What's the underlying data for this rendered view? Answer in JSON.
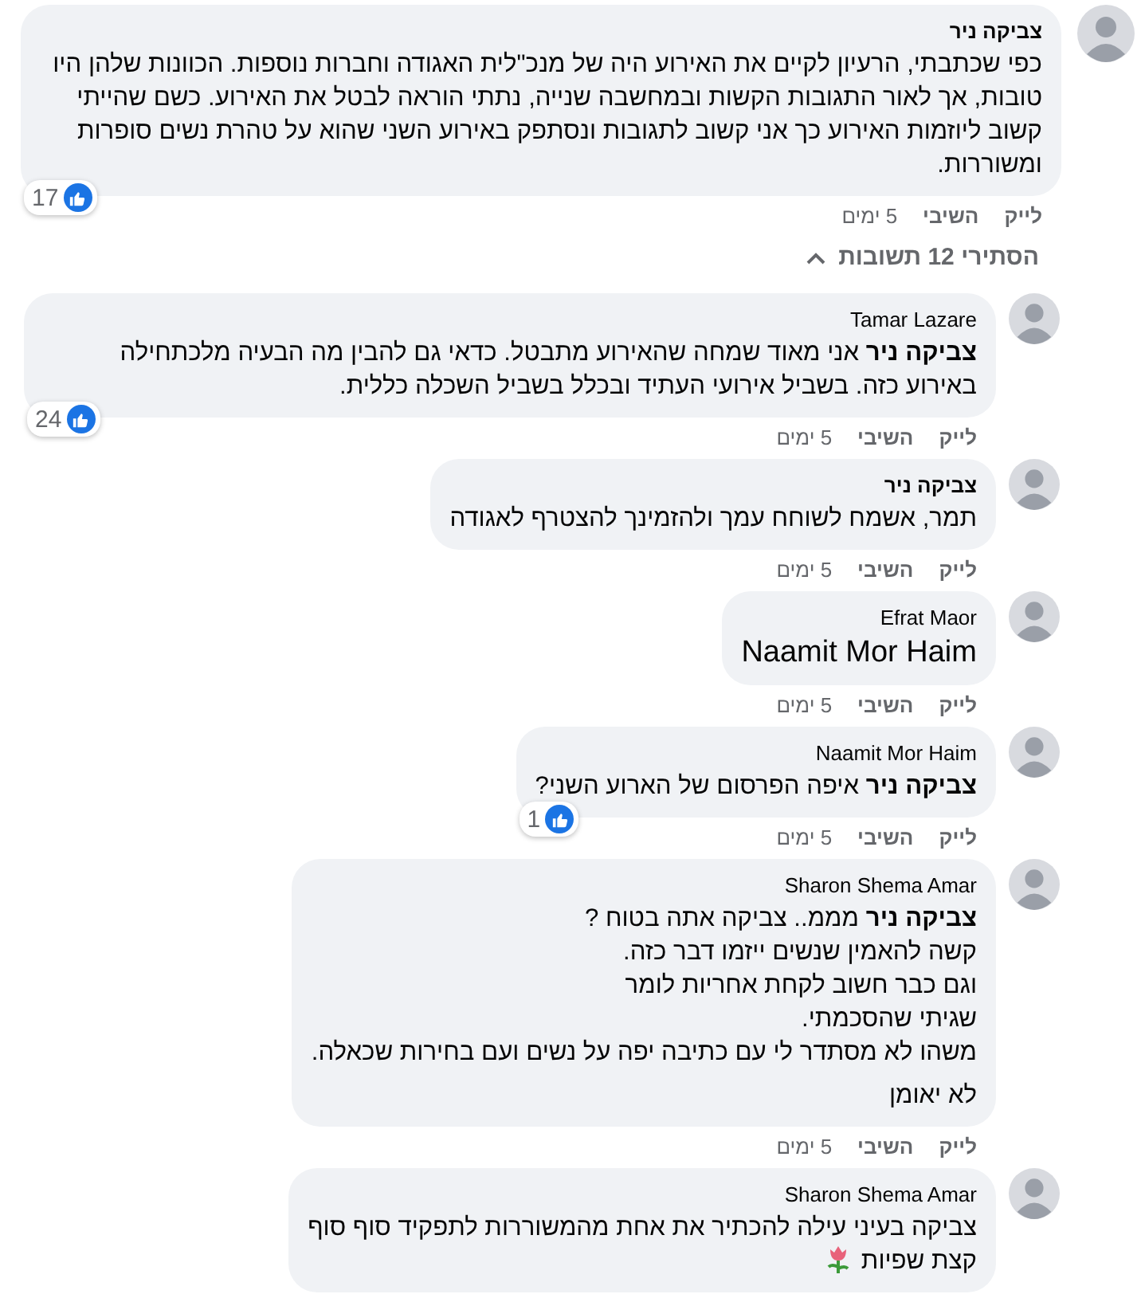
{
  "comment": {
    "author": "צביקה ניר",
    "paragraphs": [
      [
        "כפי שכתבתי, הרעיון לקיים את האירוע היה של מנכ\"לית האגודה וחברות נוספות. הכוונות שלהן היו טובות, אך לאור התגובות הקשות ובמחשבה שנייה, נתתי הוראה לבטל את האירוע. כשם שהייתי קשוב ליוזמות האירוע כך אני קשוב לתגובות ונסתפק באירוע השני שהוא על טהרת נשים סופרות ומשוררות."
      ]
    ],
    "reactions": "17",
    "actions": [
      "לייק",
      "השיבי",
      "5 ימים"
    ],
    "replies_toggle": {
      "label": "הסתירי 12 תשובות",
      "expanded": true
    },
    "replies": [
      {
        "author": "Tamar Lazare",
        "kind": "text",
        "paragraphs": [
          [
            "**צביקה ניר** אני מאוד שמחה שהאירוע מתבטל. כדאי גם להבין מה הבעיה מלכתחילה באירוע כזה. בשביל אירועי העתיד ובכלל בשביל השכלה כללית."
          ]
        ],
        "reactions": "24",
        "actions": [
          "לייק",
          "השיבי",
          "5 ימים"
        ]
      },
      {
        "author": "צביקה ניר",
        "kind": "text",
        "paragraphs": [
          [
            "תמר, אשמח לשוחח עמך ולהזמינך להצטרף לאגודה"
          ]
        ],
        "actions": [
          "לייק",
          "השיבי",
          "5 ימים"
        ]
      },
      {
        "author": "Efrat Maor",
        "kind": "mention_only",
        "paragraphs": [
          [
            "Naamit Mor Haim"
          ]
        ],
        "actions": [
          "לייק",
          "השיבי",
          "5 ימים"
        ]
      },
      {
        "author": "Naamit Mor Haim",
        "kind": "text",
        "paragraphs": [
          [
            "**צביקה ניר** איפה הפרסום של הארוע השני?"
          ]
        ],
        "reactions": "1",
        "actions": [
          "לייק",
          "השיבי",
          "5 ימים"
        ]
      },
      {
        "author": "Sharon Shema Amar",
        "kind": "text",
        "paragraphs": [
          [
            "**צביקה ניר** מממ.. צביקה אתה בטוח ?",
            "קשה להאמין שנשים ייזמו דבר כזה.",
            "וגם כבר חשוב לקחת אחריות לומר",
            "שגיתי שהסכמתי.",
            "משהו לא מסתדר לי עם כתיבה יפה על נשים ועם בחירות שכאלה."
          ],
          [
            "לא יאומן"
          ]
        ],
        "actions": [
          "לייק",
          "השיבי",
          "5 ימים"
        ]
      },
      {
        "author": "Sharon Shema Amar",
        "kind": "text",
        "paragraphs": [
          [
            "צביקה בעיני עילה להכתיר את אחת מהמשוררות לתפקיד סוף סוף",
            "קצת שפיות"
          ]
        ],
        "has_emoji": true
      }
    ]
  }
}
